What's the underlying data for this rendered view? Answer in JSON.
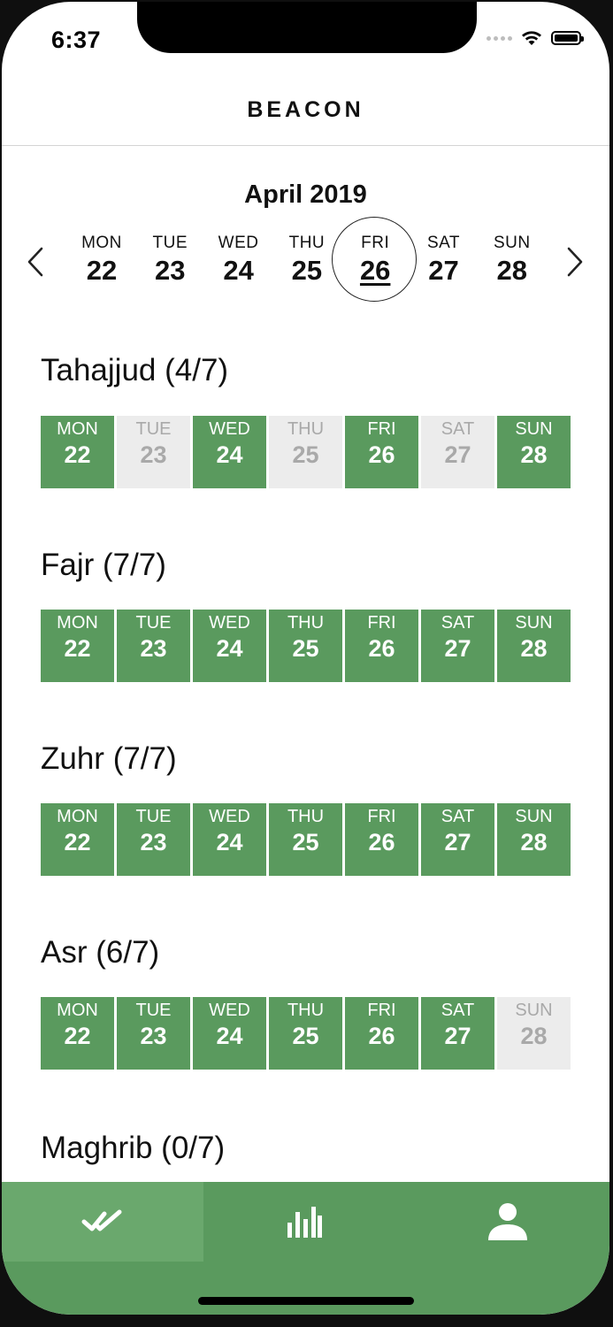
{
  "status_bar": {
    "time": "6:37"
  },
  "nav": {
    "title": "BEACON"
  },
  "calendar": {
    "month_label": "April 2019",
    "selected_index": 4,
    "week": [
      {
        "name": "MON",
        "date": "22"
      },
      {
        "name": "TUE",
        "date": "23"
      },
      {
        "name": "WED",
        "date": "24"
      },
      {
        "name": "THU",
        "date": "25"
      },
      {
        "name": "FRI",
        "date": "26"
      },
      {
        "name": "SAT",
        "date": "27"
      },
      {
        "name": "SUN",
        "date": "28"
      }
    ]
  },
  "prayers": [
    {
      "title": "Tahajjud (4/7)",
      "days": [
        {
          "name": "MON",
          "date": "22",
          "done": true
        },
        {
          "name": "TUE",
          "date": "23",
          "done": false
        },
        {
          "name": "WED",
          "date": "24",
          "done": true
        },
        {
          "name": "THU",
          "date": "25",
          "done": false
        },
        {
          "name": "FRI",
          "date": "26",
          "done": true
        },
        {
          "name": "SAT",
          "date": "27",
          "done": false
        },
        {
          "name": "SUN",
          "date": "28",
          "done": true
        }
      ]
    },
    {
      "title": "Fajr (7/7)",
      "days": [
        {
          "name": "MON",
          "date": "22",
          "done": true
        },
        {
          "name": "TUE",
          "date": "23",
          "done": true
        },
        {
          "name": "WED",
          "date": "24",
          "done": true
        },
        {
          "name": "THU",
          "date": "25",
          "done": true
        },
        {
          "name": "FRI",
          "date": "26",
          "done": true
        },
        {
          "name": "SAT",
          "date": "27",
          "done": true
        },
        {
          "name": "SUN",
          "date": "28",
          "done": true
        }
      ]
    },
    {
      "title": "Zuhr (7/7)",
      "days": [
        {
          "name": "MON",
          "date": "22",
          "done": true
        },
        {
          "name": "TUE",
          "date": "23",
          "done": true
        },
        {
          "name": "WED",
          "date": "24",
          "done": true
        },
        {
          "name": "THU",
          "date": "25",
          "done": true
        },
        {
          "name": "FRI",
          "date": "26",
          "done": true
        },
        {
          "name": "SAT",
          "date": "27",
          "done": true
        },
        {
          "name": "SUN",
          "date": "28",
          "done": true
        }
      ]
    },
    {
      "title": "Asr (6/7)",
      "days": [
        {
          "name": "MON",
          "date": "22",
          "done": true
        },
        {
          "name": "TUE",
          "date": "23",
          "done": true
        },
        {
          "name": "WED",
          "date": "24",
          "done": true
        },
        {
          "name": "THU",
          "date": "25",
          "done": true
        },
        {
          "name": "FRI",
          "date": "26",
          "done": true
        },
        {
          "name": "SAT",
          "date": "27",
          "done": true
        },
        {
          "name": "SUN",
          "date": "28",
          "done": false
        }
      ]
    },
    {
      "title": "Maghrib (0/7)",
      "days": []
    }
  ],
  "tab_bar": {
    "tabs": [
      {
        "icon": "double-check-icon",
        "active": true
      },
      {
        "icon": "bar-chart-icon",
        "active": false
      },
      {
        "icon": "person-icon",
        "active": false
      }
    ]
  },
  "colors": {
    "done": "#5a9a5e",
    "missed": "#ececec",
    "tab_bar": "#5a9a5e",
    "tab_active": "#6aa86d"
  }
}
